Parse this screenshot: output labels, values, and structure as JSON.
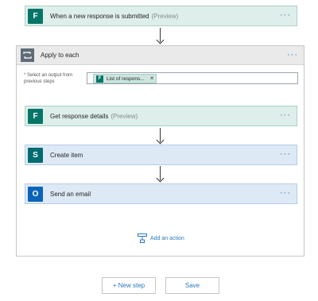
{
  "trigger": {
    "title": "When a new response is submitted",
    "tag": "(Preview)",
    "icon": "forms-icon",
    "more": "···"
  },
  "apply_each": {
    "title": "Apply to each",
    "more": "···",
    "select_label": "Select an output from previous steps",
    "required_mark": "*",
    "token_label": "List of respons...",
    "token_remove": "×"
  },
  "steps": [
    {
      "title": "Get response details",
      "tag": "(Preview)",
      "icon": "forms-icon",
      "more": "···"
    },
    {
      "title": "Create item",
      "tag": "",
      "icon": "sharepoint-icon",
      "more": "···"
    },
    {
      "title": "Send an email",
      "tag": "",
      "icon": "outlook-icon",
      "more": "···"
    }
  ],
  "icon_letters": {
    "forms": "F",
    "sharepoint": "S",
    "outlook": "O"
  },
  "add_action_label": "Add an action",
  "footer": {
    "new_step_label": "+ New step",
    "save_label": "Save"
  },
  "colors": {
    "forms": "#077568",
    "sharepoint": "#036c70",
    "outlook": "#0a64b8",
    "link": "#2b79c0"
  }
}
